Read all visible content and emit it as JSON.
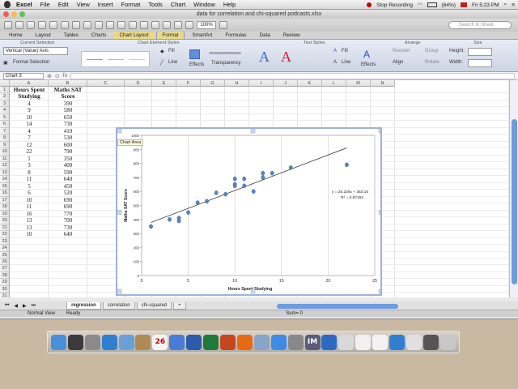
{
  "menubar": {
    "items": [
      "Excel",
      "File",
      "Edit",
      "View",
      "Insert",
      "Format",
      "Tools",
      "Chart",
      "Window",
      "Help"
    ],
    "recording": "Stop Recording",
    "battery": "(64%)",
    "clock": "Fri 5:23 PM"
  },
  "window": {
    "title": "data for correlation and chi-squared podcasts.xlsx",
    "zoom": "100%",
    "search_placeholder": "Search in Sheet"
  },
  "ribbon": {
    "tabs": [
      "Home",
      "Layout",
      "Tables",
      "Charts",
      "Chart Layout",
      "Format",
      "SmartArt",
      "Formulas",
      "Data",
      "Review"
    ],
    "active_tab": "Format",
    "groups": {
      "current_selection": "Current Selection",
      "chart_element_styles": "Chart Element Styles",
      "text_styles": "Text Styles",
      "arrange": "Arrange",
      "size": "Size"
    },
    "selection_value": "Vertical (Value) Axis",
    "format_selection": "Format Selection",
    "fill": "Fill",
    "line": "Line",
    "effects": "Effects",
    "transparency": "Transparency",
    "text_fill": "Fill",
    "text_line": "Line",
    "text_effects": "Effects",
    "reorder": "Reorder",
    "group": "Group",
    "align": "Align",
    "rotate": "Rotate",
    "height": "Height:",
    "width": "Width:"
  },
  "formula_bar": {
    "name_box": "Chart 3"
  },
  "sheet": {
    "columns": [
      "A",
      "B",
      "C",
      "D",
      "E",
      "F",
      "G",
      "H",
      "I",
      "J",
      "K",
      "L",
      "M",
      "N"
    ],
    "headers": {
      "a1": "Hours Spent",
      "a2": "Studying",
      "b1": "Maths SAT",
      "b2": "Score"
    },
    "rows": [
      [
        "4",
        "390"
      ],
      [
        "9",
        "580"
      ],
      [
        "10",
        "650"
      ],
      [
        "14",
        "730"
      ],
      [
        "4",
        "410"
      ],
      [
        "7",
        "530"
      ],
      [
        "12",
        "600"
      ],
      [
        "22",
        "790"
      ],
      [
        "1",
        "350"
      ],
      [
        "3",
        "400"
      ],
      [
        "8",
        "590"
      ],
      [
        "11",
        "640"
      ],
      [
        "5",
        "450"
      ],
      [
        "6",
        "520"
      ],
      [
        "10",
        "690"
      ],
      [
        "11",
        "690"
      ],
      [
        "16",
        "770"
      ],
      [
        "13",
        "700"
      ],
      [
        "13",
        "730"
      ],
      [
        "10",
        "640"
      ]
    ],
    "row_numbers": [
      "1",
      "2",
      "3",
      "4",
      "5",
      "6",
      "7",
      "8",
      "9",
      "10",
      "11",
      "12",
      "13",
      "14",
      "15",
      "16",
      "17",
      "18",
      "19",
      "20",
      "21",
      "22",
      "23",
      "24",
      "25",
      "26",
      "27",
      "28",
      "29",
      "30",
      "31"
    ],
    "tabs": [
      "regression",
      "correlation",
      "chi-squared"
    ],
    "add_tab": "+"
  },
  "chart": {
    "tooltip": "Chart Area"
  },
  "chart_data": {
    "type": "scatter",
    "xlabel": "Hours Spent Studying",
    "ylabel": "Maths SAT Score",
    "xlim": [
      0,
      25
    ],
    "ylim": [
      0,
      1000
    ],
    "xticks": [
      0,
      5,
      10,
      15,
      20,
      25
    ],
    "yticks": [
      0,
      100,
      200,
      300,
      400,
      500,
      600,
      700,
      800,
      900,
      1000
    ],
    "x": [
      4,
      9,
      10,
      14,
      4,
      7,
      12,
      22,
      1,
      3,
      8,
      11,
      5,
      6,
      10,
      11,
      16,
      13,
      13,
      10
    ],
    "y": [
      390,
      580,
      650,
      730,
      410,
      530,
      600,
      790,
      350,
      400,
      590,
      640,
      450,
      520,
      690,
      690,
      770,
      700,
      730,
      640
    ],
    "trendline": {
      "slope": 25.326,
      "intercept": 353.16,
      "x_range": [
        1,
        22
      ]
    },
    "equation": "y = 25.326x + 353.16",
    "r_squared": "R² = 0.87162",
    "grid": "vertical"
  },
  "status": {
    "view": "Normal View",
    "ready": "Ready",
    "sum": "Sum= 0"
  },
  "dock": {
    "apps": [
      "finder-icon",
      "dashboard-icon",
      "launchpad-icon",
      "safari-icon",
      "mail-icon",
      "contacts-icon",
      "calendar-icon",
      "itunes-icon",
      "word-icon",
      "excel-icon",
      "powerpoint-icon",
      "firefox-icon",
      "preview-icon",
      "dropbox-icon",
      "settings-icon",
      "im-icon",
      "quicktime-icon",
      "x-icon",
      "textedit-icon",
      "pen-icon",
      "safari2-icon",
      "chrome-icon",
      "spark-icon",
      "trash-icon"
    ],
    "labels": {
      "calendar": "26",
      "im": "IM"
    }
  }
}
